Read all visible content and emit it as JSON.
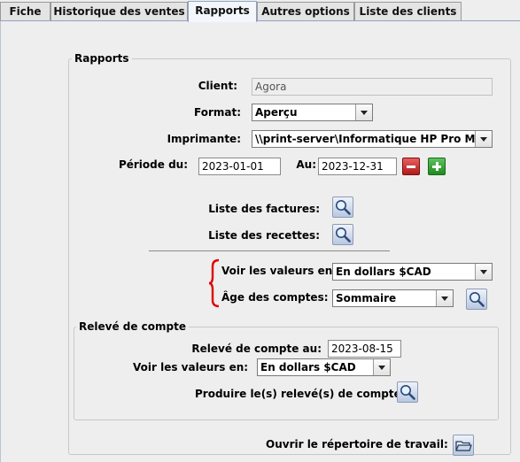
{
  "tabs": [
    "Fiche",
    "Historique des ventes",
    "Rapports",
    "Autres options",
    "Liste des clients"
  ],
  "active_tab": "Rapports",
  "reports": {
    "title": "Rapports",
    "client_label": "Client:",
    "client_value": "Agora",
    "format_label": "Format:",
    "format_value": "Aperçu",
    "printer_label": "Imprimante:",
    "printer_value": "\\\\print-server\\Informatique HP Pro M...",
    "period_from_label": "Période du:",
    "period_from_value": "2023-01-01",
    "period_to_label": "Au:",
    "period_to_value": "2023-12-31",
    "invoices_label": "Liste des factures:",
    "receipts_label": "Liste des recettes:",
    "show_values_label": "Voir les valeurs en:",
    "show_values_value": "En dollars $CAD",
    "account_age_label": "Âge des comptes:",
    "account_age_value": "Sommaire"
  },
  "statement": {
    "title": "Relevé de compte",
    "date_label": "Relevé de compte au:",
    "date_value": "2023-08-15",
    "show_values_label": "Voir les valeurs en:",
    "show_values_value": "En dollars $CAD",
    "produce_label": "Produire le(s) relevé(s) de compte:"
  },
  "open_dir_label": "Ouvrir le répertoire de travail:",
  "colors": {
    "accent_tab": "#f3f6fa",
    "brace": "#e00000",
    "minus": "#c62828",
    "plus": "#2e8b2e"
  }
}
